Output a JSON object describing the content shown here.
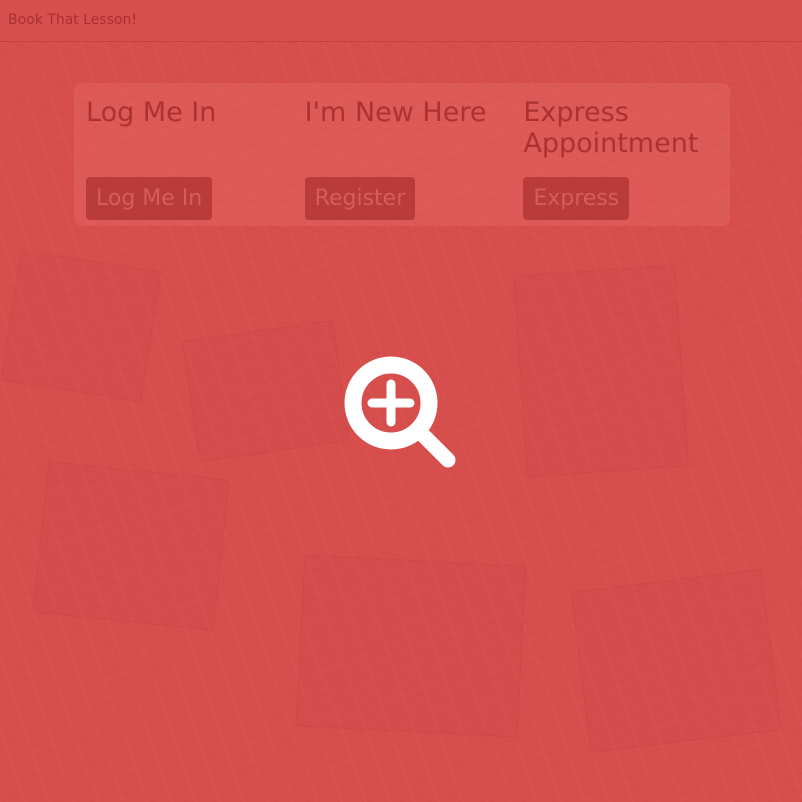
{
  "navbar": {
    "brand": "Book That Lesson!"
  },
  "cards": [
    {
      "title": "Log Me In",
      "button_label": "Log Me In"
    },
    {
      "title": "I'm New Here",
      "button_label": "Register"
    },
    {
      "title": "Express Appointment",
      "button_label": "Express"
    }
  ],
  "overlay": {
    "icon": "zoom-in-icon"
  },
  "colors": {
    "background": "#d7514f",
    "heading": "#a12e2d",
    "button": "#b23a38",
    "icon": "#ffffff"
  }
}
